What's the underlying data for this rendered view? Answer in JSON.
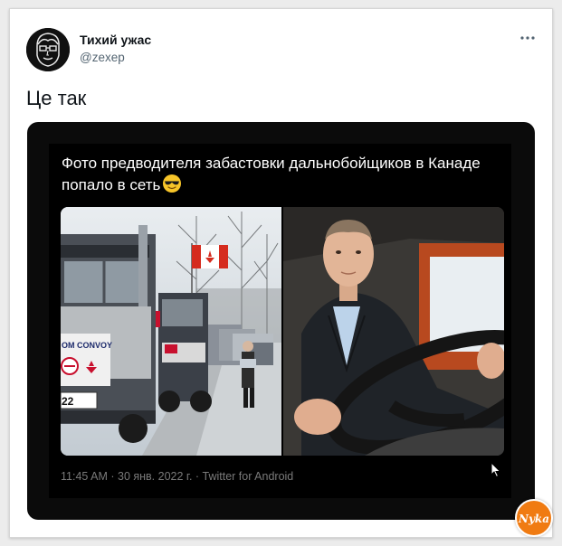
{
  "tweet": {
    "author_name": "Тихий ужас",
    "author_handle": "@zexep",
    "text": "Це так",
    "more_icon": "more-dots-icon"
  },
  "media": {
    "caption": "Фото предводителя забастовки дальнобойщиков в Канаде попало в сеть",
    "caption_emoji": "sunglasses-emoji",
    "truck_sign": "OM CONVOY",
    "plate_number": "22",
    "timestamp": "11:45 AM · 30 янв. 2022 г. · Twitter for Android"
  },
  "watermark": {
    "logo_name": "nyka-logo",
    "text": "Nyka"
  },
  "colors": {
    "accent_orange": "#f07b12",
    "media_bg": "#0b0b0b",
    "meta_text": "#7a7a7a"
  }
}
